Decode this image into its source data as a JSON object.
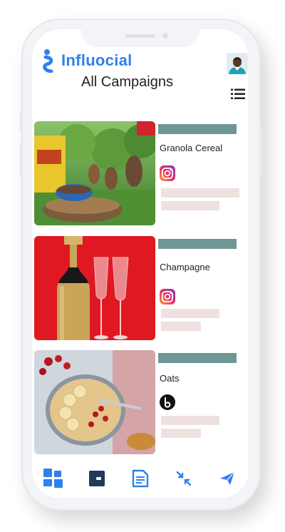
{
  "app": {
    "brand": "Influocial",
    "page_title": "All Campaigns"
  },
  "colors": {
    "brand_blue": "#2f80ed",
    "bar_teal": "#6e9796",
    "placeholder_pink": "#f0e1e1",
    "nav_dark": "#1f3a5a"
  },
  "campaigns": [
    {
      "title": "Granola Cereal",
      "platform": "instagram-icon"
    },
    {
      "title": "Champagne",
      "platform": "instagram-icon"
    },
    {
      "title": "Oats",
      "platform": "tiktok-style-icon"
    }
  ],
  "nav": [
    {
      "name": "dashboard-icon"
    },
    {
      "name": "wallet-icon"
    },
    {
      "name": "document-icon"
    },
    {
      "name": "compress-arrows-icon"
    },
    {
      "name": "send-icon"
    }
  ]
}
